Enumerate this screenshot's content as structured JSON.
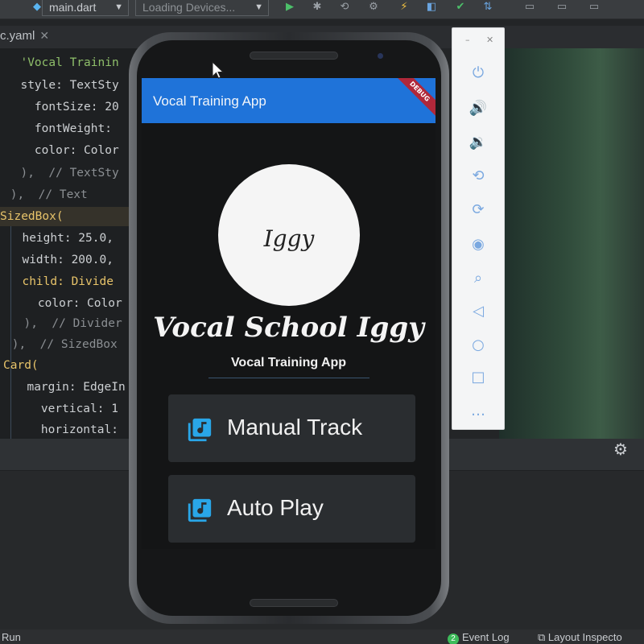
{
  "ide": {
    "toolbar": {
      "file_dropdown": "main.dart",
      "device_dropdown": "Loading Devices..."
    },
    "tab": {
      "label": "c.yaml",
      "close_glyph": "✕"
    },
    "code_lines": [
      "  'Vocal Trainin",
      "  style: TextSty",
      "    fontSize: 20",
      "    fontWeight:",
      "    color: Color",
      "  ),  // TextSty",
      " ),  // Text",
      "SizedBox(",
      "  height: 25.0,",
      "  width: 200.0,",
      "  child: Divide",
      "    color: Color",
      "  ),  // Divider",
      " ),  // SizedBox",
      "Card(",
      "  margin: EdgeIn",
      "    vertical: 1",
      "    horizontal:"
    ],
    "status": {
      "run": "Run",
      "event_log_count": "2",
      "event_log": "Event Log",
      "layout_inspector": "Layout Inspecto"
    }
  },
  "emulator_toolbar": {
    "buttons": [
      "power-icon",
      "volume-up-icon",
      "volume-down-icon",
      "rotate-left-icon",
      "rotate-right-icon",
      "camera-icon",
      "zoom-icon",
      "back-icon",
      "home-icon",
      "overview-icon",
      "more-icon"
    ]
  },
  "app": {
    "appbar_title": "Vocal Training App",
    "debug_banner": "DEBUG",
    "avatar_text": "Iggy",
    "name": "Vocal School Iggy",
    "subtitle": "Vocal Training App",
    "cards": [
      {
        "label": "Manual Track",
        "icon": "library-music-icon"
      },
      {
        "label": "Auto Play",
        "icon": "library-music-icon"
      }
    ],
    "colors": {
      "appbar": "#1f73d9",
      "icon_accent": "#29a6e8",
      "card": "#2a2d30",
      "screen": "#141516"
    }
  }
}
